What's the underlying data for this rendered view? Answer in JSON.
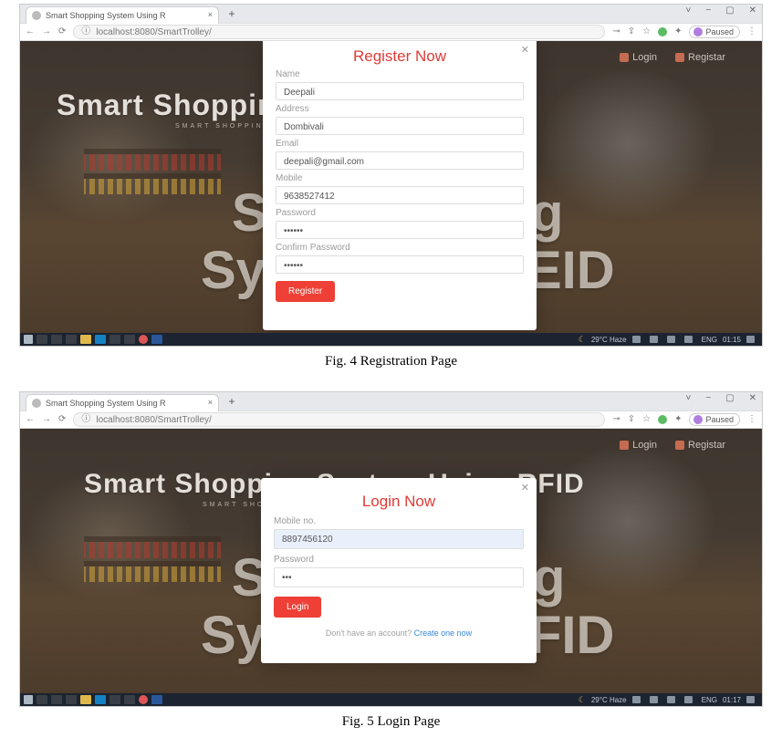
{
  "browser": {
    "tab_title": "Smart Shopping System Using R",
    "url": "localhost:8080/SmartTrolley/",
    "paused": "Paused",
    "glyph": {
      "back": "←",
      "fwd": "→",
      "reload": "⟳",
      "info": "ⓘ",
      "key": "⊸",
      "share": "⇪",
      "star": "☆",
      "puzzle": "✦",
      "more": "⋮",
      "min": "−",
      "max": "▢",
      "close": "✕",
      "chev": "˅"
    }
  },
  "nav": {
    "login": "Login",
    "register": "Registar"
  },
  "hero": {
    "title_short": "Smart Shoppin",
    "title_full": "Smart Shopping System Using RFID",
    "sub": "SMART SHOPPING",
    "big_sys": "Sys",
    "big_s": "S",
    "big_g": "g",
    "big_efid": "EID",
    "big_fid": "FID"
  },
  "register": {
    "title": "Register Now",
    "name_label": "Name",
    "name_value": "Deepali",
    "address_label": "Address",
    "address_value": "Dombivali",
    "email_label": "Email",
    "email_value": "deepali@gmail.com",
    "mobile_label": "Mobile",
    "mobile_value": "9638527412",
    "password_label": "Password",
    "password_value": "••••••",
    "confirm_label": "Confirm Password",
    "confirm_value": "••••••",
    "button": "Register",
    "close": "✕"
  },
  "login": {
    "title": "Login Now",
    "mobile_label": "Mobile no.",
    "mobile_value": "8897456120",
    "password_label": "Password",
    "password_value": "•••",
    "button": "Login",
    "helper_pre": "Don't have an account? ",
    "helper_link": "Create one now",
    "close": "✕"
  },
  "taskbar": {
    "weather": "29°C Haze",
    "lang": "ENG",
    "time1": "01:15",
    "time2": "01:17"
  },
  "captions": {
    "fig4": "Fig. 4 Registration Page",
    "fig5": "Fig. 5 Login Page"
  }
}
